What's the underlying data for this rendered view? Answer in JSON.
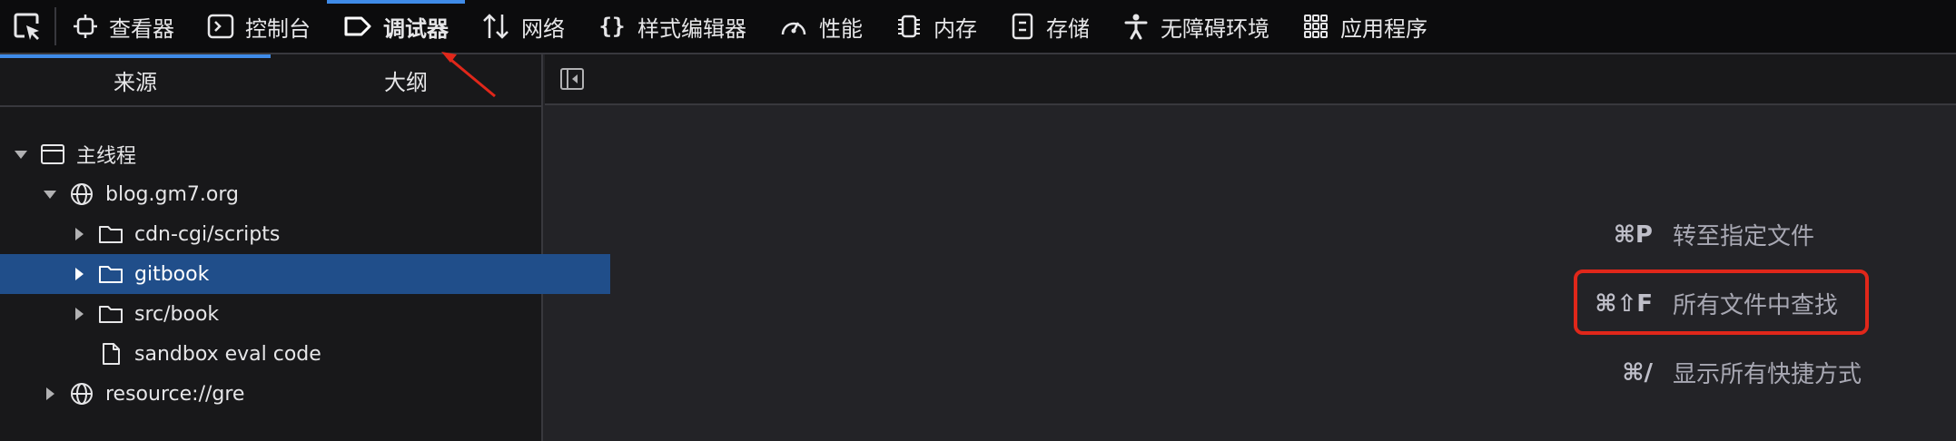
{
  "toolbar": {
    "picker_icon": "element-picker-icon",
    "tabs": [
      {
        "label": "查看器",
        "icon": "inspector-icon"
      },
      {
        "label": "控制台",
        "icon": "console-icon"
      },
      {
        "label": "调试器",
        "icon": "debugger-icon",
        "active": true
      },
      {
        "label": "网络",
        "icon": "network-icon"
      },
      {
        "label": "样式编辑器",
        "icon": "style-editor-icon"
      },
      {
        "label": "性能",
        "icon": "performance-icon"
      },
      {
        "label": "内存",
        "icon": "memory-icon"
      },
      {
        "label": "存储",
        "icon": "storage-icon"
      },
      {
        "label": "无障碍环境",
        "icon": "accessibility-icon"
      },
      {
        "label": "应用程序",
        "icon": "application-icon"
      }
    ]
  },
  "sources_panel": {
    "tabs": [
      "来源",
      "大纲"
    ],
    "tree": [
      {
        "label": "主线程",
        "icon": "window-icon",
        "expanded": true
      },
      {
        "label": "blog.gm7.org",
        "icon": "globe-icon",
        "expanded": true
      },
      {
        "label": "cdn-cgi/scripts",
        "icon": "folder-icon",
        "expanded": false
      },
      {
        "label": "gitbook",
        "icon": "folder-icon",
        "expanded": false,
        "selected": true
      },
      {
        "label": "src/book",
        "icon": "folder-icon",
        "expanded": false
      },
      {
        "label": "sandbox eval code",
        "icon": "file-icon"
      },
      {
        "label": "resource://gre",
        "icon": "globe-icon",
        "expanded": false
      }
    ]
  },
  "shortcuts": [
    {
      "key": "⌘P",
      "label": "转至指定文件"
    },
    {
      "key": "⌘⇧F",
      "label": "所有文件中查找",
      "highlighted": true
    },
    {
      "key": "⌘/",
      "label": "显示所有快捷方式"
    }
  ],
  "colors": {
    "accent": "#3f8be8",
    "selection": "#204e8a",
    "annotation": "#e0271a"
  }
}
